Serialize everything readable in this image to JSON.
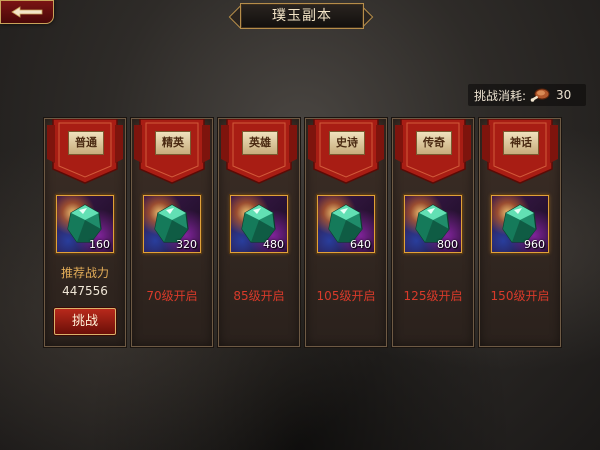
{
  "header": {
    "title": "璞玉副本"
  },
  "cost": {
    "label": "挑战消耗:",
    "value": "30",
    "icon": "meat-icon"
  },
  "colors": {
    "unlock_text": "#d83a2a",
    "power_label": "#e3ad58",
    "banner_red": "#a81d14"
  },
  "tiers": [
    {
      "name": "普通",
      "gem_count": "160",
      "power_label": "推荐战力",
      "power_value": "447556",
      "button_label": "挑战"
    },
    {
      "name": "精英",
      "gem_count": "320",
      "unlock": "70级开启"
    },
    {
      "name": "英雄",
      "gem_count": "480",
      "unlock": "85级开启"
    },
    {
      "name": "史诗",
      "gem_count": "640",
      "unlock": "105级开启"
    },
    {
      "name": "传奇",
      "gem_count": "800",
      "unlock": "125级开启"
    },
    {
      "name": "神话",
      "gem_count": "960",
      "unlock": "150级开启"
    }
  ]
}
